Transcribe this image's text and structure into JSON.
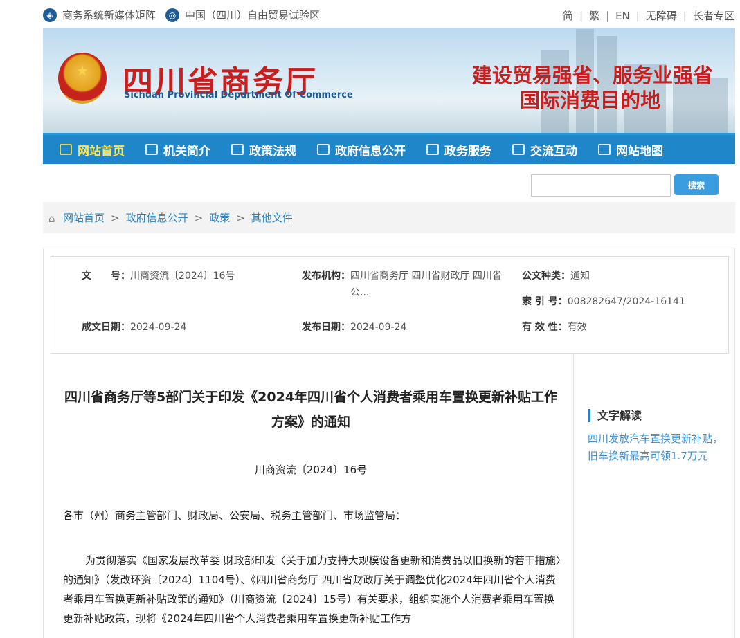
{
  "topbar": {
    "links": [
      "商务系统新媒体矩阵",
      "中国（四川）自由贸易试验区"
    ],
    "right": [
      "简",
      "繁",
      "EN",
      "无障碍",
      "长者专区"
    ]
  },
  "banner": {
    "title_cn": "四川省商务厅",
    "title_en": "Sichuan Provincial Department Of Commerce",
    "slogan_line1": "建设贸易强省、服务业强省",
    "slogan_line2": "国际消费目的地"
  },
  "nav": {
    "items": [
      "网站首页",
      "机关简介",
      "政策法规",
      "政府信息公开",
      "政务服务",
      "交流互动",
      "网站地图"
    ],
    "active_index": 0
  },
  "search": {
    "placeholder": "",
    "button_label": "搜索"
  },
  "breadcrumb": [
    "网站首页",
    "政府信息公开",
    "政策",
    "其他文件"
  ],
  "meta": {
    "doc_no_label": "文　　号：",
    "doc_no": "川商资流〔2024〕16号",
    "publisher_label": "发布机构：",
    "publisher": "四川省商务厅 四川省财政厅 四川省公...",
    "type_label": "公文种类：",
    "type": "通知",
    "index_label": "索 引 号：",
    "index": "008282647/2024-16141",
    "created_label": "成文日期：",
    "created": "2024-09-24",
    "published_label": "发布日期：",
    "published": "2024-09-24",
    "validity_label": "有 效 性：",
    "validity": "有效"
  },
  "article": {
    "title": "四川省商务厅等5部门关于印发《2024年四川省个人消费者乘用车置换更新补贴工作方案》的通知",
    "doc_no": "川商资流〔2024〕16号",
    "addressee": "各市（州）商务主管部门、财政局、公安局、税务主管部门、市场监管局：",
    "body": "为贯彻落实《国家发展改革委 财政部印发〈关于加力支持大规模设备更新和消费品以旧换新的若干措施〉的通知》（发改环资〔2024〕1104号）、《四川省商务厅 四川省财政厅关于调整优化2024年四川省个人消费者乘用车置换更新补贴政策的通知》（川商资流〔2024〕15号）有关要求，组织实施个人消费者乘用车置换更新补贴政策，现将《2024年四川省个人消费者乘用车置换更新补贴工作方"
  },
  "side": {
    "title": "文字解读",
    "link": "四川发放汽车置换更新补贴，旧车换新最高可领1.7万元"
  },
  "colors": {
    "nav_bg": "#1f86c9",
    "nav_active": "#ffe34d",
    "brand_red": "#c81e1e",
    "link_blue": "#2d82c0"
  }
}
